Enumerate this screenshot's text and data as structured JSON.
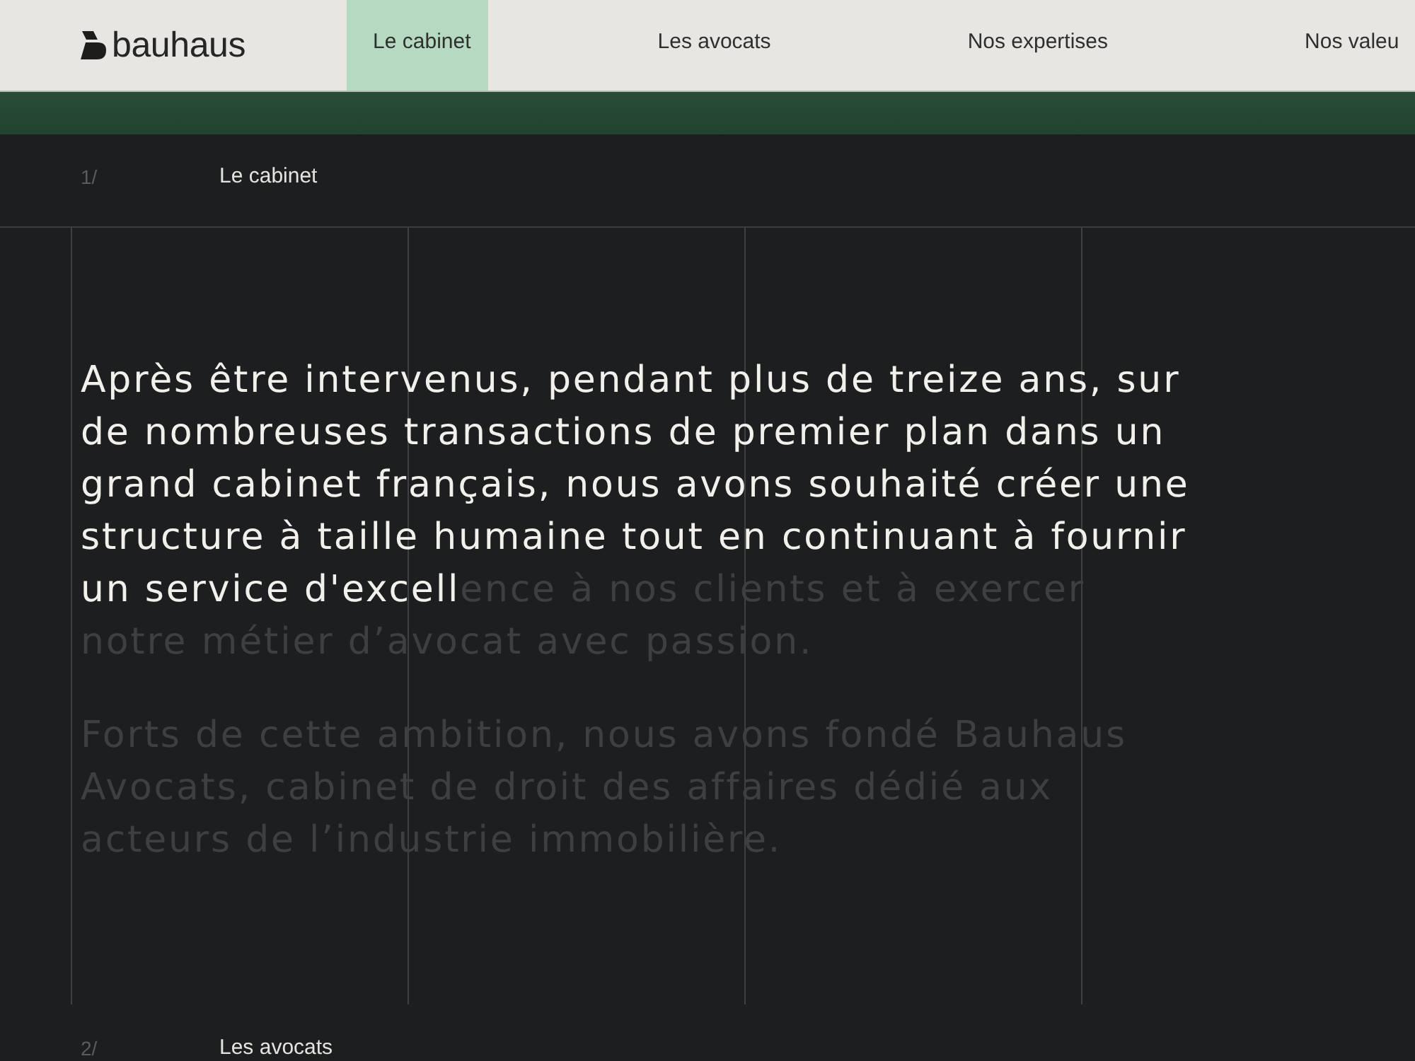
{
  "header": {
    "logo": {
      "text": "bauhaus"
    },
    "nav": [
      {
        "label": "Le cabinet",
        "selected": true
      },
      {
        "label": "Les avocats",
        "selected": false
      },
      {
        "label": "Nos expertises",
        "selected": false
      },
      {
        "label": "Nos valeu",
        "selected": false
      }
    ]
  },
  "sections": [
    {
      "number": "1/",
      "title": "Le cabinet",
      "paragraphs": [
        {
          "segments": [
            {
              "text": "Après être intervenus, pendant plus de treize ans, sur de nombreuses transactions de premier plan dans un grand cabinet français, nous avons souhaité créer une structure à taille humaine tout en continuant à fournir un service d'excell",
              "highlighted": true
            },
            {
              "text": "ence à nos clients et à exercer notre métier d’avocat avec passion.",
              "highlighted": false
            }
          ]
        },
        {
          "segments": [
            {
              "text": "Forts de cette ambition, nous avons fondé Bauhaus Avocats, cabinet de droit des affaires dédié aux acteurs de l’industrie immobilière.",
              "highlighted": false
            }
          ]
        }
      ]
    },
    {
      "number": "2/",
      "title": "Les avocats"
    }
  ]
}
